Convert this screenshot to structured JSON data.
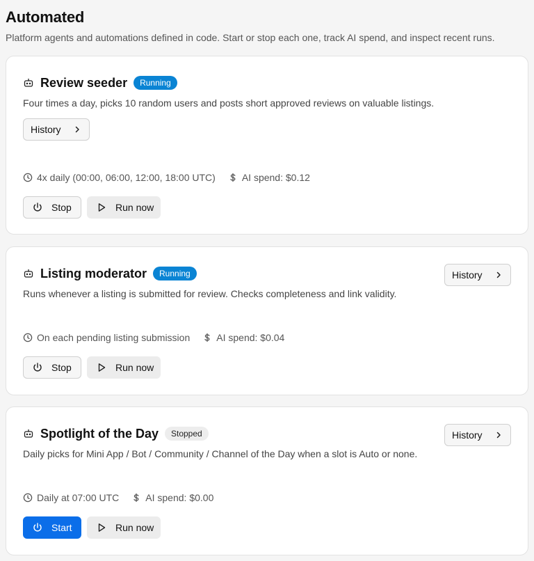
{
  "page": {
    "title": "Automated",
    "subtitle": "Platform agents and automations defined in code. Start or stop each one, track AI spend, and inspect recent runs."
  },
  "labels": {
    "history": "History",
    "stop": "Stop",
    "start": "Start",
    "run_now": "Run now"
  },
  "icons": {
    "bot": "bot-icon",
    "clock": "clock-icon",
    "dollar": "dollar-icon",
    "power": "power-icon",
    "play": "play-icon",
    "chevron": "chevron-right-icon"
  },
  "colors": {
    "running_badge": "#0a84d4",
    "start_button": "#0b6ee9"
  },
  "automations": [
    {
      "name": "Review seeder",
      "status": "Running",
      "description": "Four times a day, picks 10 random users and posts short approved reviews on valuable listings.",
      "schedule": "4x daily (00:00, 06:00, 12:00, 18:00 UTC)",
      "ai_spend": "AI spend: $0.12"
    },
    {
      "name": "Listing moderator",
      "status": "Running",
      "description": "Runs whenever a listing is submitted for review. Checks completeness and link validity.",
      "schedule": "On each pending listing submission",
      "ai_spend": "AI spend: $0.04"
    },
    {
      "name": "Spotlight of the Day",
      "status": "Stopped",
      "description": "Daily picks for Mini App / Bot / Community / Channel of the Day when a slot is Auto or none.",
      "schedule": "Daily at 07:00 UTC",
      "ai_spend": "AI spend: $0.00"
    }
  ]
}
